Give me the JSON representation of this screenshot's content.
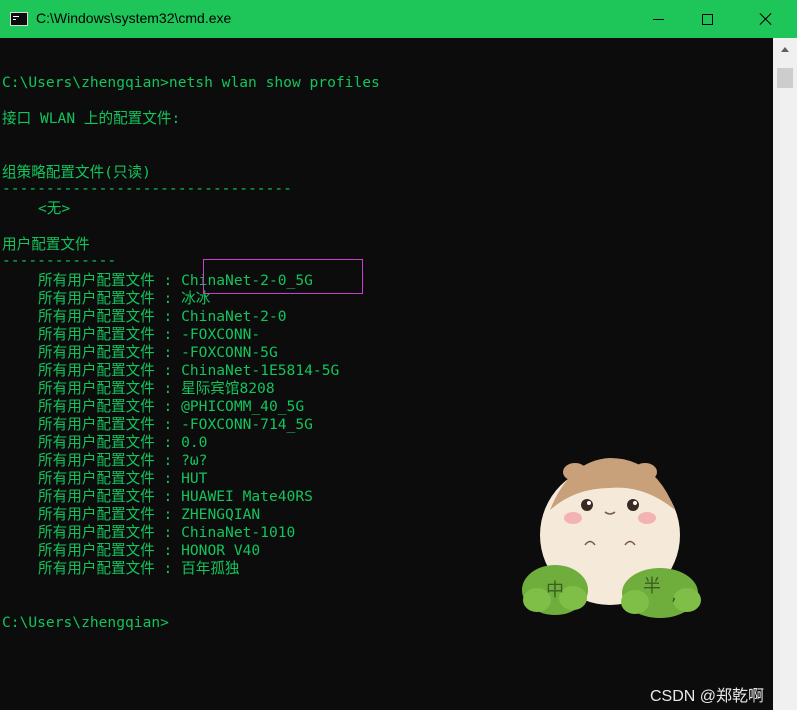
{
  "window": {
    "title": "C:\\Windows\\system32\\cmd.exe"
  },
  "console": {
    "command_line": "C:\\Users\\zhengqian>netsh wlan show profiles",
    "interface_header": "接口 WLAN 上的配置文件:",
    "group_policy_header": "组策略配置文件(只读)",
    "group_policy_divider": "---------------------------------",
    "group_policy_none": "<无>",
    "user_profiles_header": "用户配置文件",
    "user_profiles_divider": "-------------",
    "profile_label": "所有用户配置文件 : ",
    "profiles": [
      "ChinaNet-2-0_5G",
      "冰冰",
      "ChinaNet-2-0",
      "-FOXCONN-",
      "-FOXCONN-5G",
      "ChinaNet-1E5814-5G",
      "星际宾馆8208",
      "@PHICOMM_40_5G",
      "-FOXCONN-714_5G",
      "0.0",
      "?ω?",
      "HUT",
      "HUAWEI Mate40RS",
      "ZHENGQIAN",
      "ChinaNet-1010",
      "HONOR V40",
      "百年孤独"
    ],
    "prompt": "C:\\Users\\zhengqian>"
  },
  "sticker": {
    "left_text": "中",
    "right_text": "半",
    "comma": ","
  },
  "watermark": {
    "text": "CSDN @郑乾啊"
  },
  "colors": {
    "titlebar": "#1ec65a",
    "console_bg": "#0c0c0c",
    "console_text": "#13c45c",
    "highlight_border": "#c83fcf"
  }
}
